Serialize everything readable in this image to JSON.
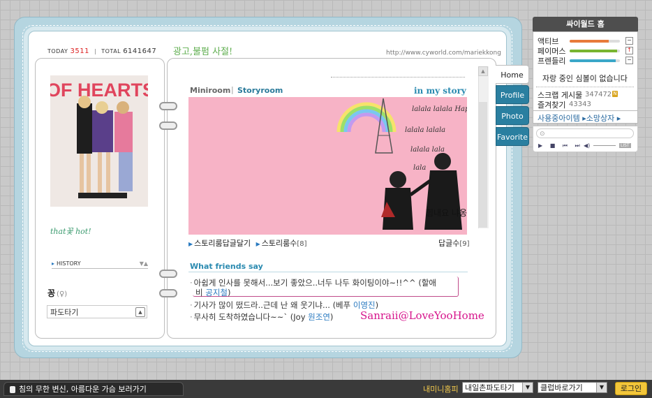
{
  "header": {
    "today_label": "TODAY",
    "today_count": "3511",
    "total_label": "TOTAL",
    "total_count": "6141647",
    "title": "광고,불펌 사절!",
    "url": "http://www.cyworld.com/mariekkong"
  },
  "left_page": {
    "profile_image_text": "OF HEARTS",
    "profile_note": "that꽃 hot!",
    "history_label": "HISTORY",
    "owner_name": "꽁",
    "owner_gender": "(♀)",
    "pado_label": "파도타기"
  },
  "right_page": {
    "tab_miniroom": "Miniroom",
    "tab_storyroom": "Storyroom",
    "in_my_story": "in my story",
    "story_image_text": "lalala lalala Happy lalala",
    "story_image_caption": "힘내요 냐옹",
    "story_reply_link": "스토리룸답글달기",
    "story_count_link": "스토리룸수",
    "story_count": "[8]",
    "reply_label": "답글수",
    "reply_count": "[9]",
    "friends_title": "What friends say",
    "comments": [
      {
        "text": "아쉽게 인사를 못해서...보기 좋았으..너두 나두 화이팅이야~!!^^ (할애",
        "cont": "비",
        "who": "공지철",
        "tail": ")"
      },
      {
        "text": "기사가 많이 떴드라..근데 난 왜 웃기냐... (베푸 ",
        "who": "이영진",
        "tail": ")"
      },
      {
        "text": "무사히 도착하였습니다~~` (Joy ",
        "who": "원조연",
        "tail": ")"
      }
    ],
    "watermark": "Sanraii@LoveYooHome"
  },
  "side_tabs": [
    "Home",
    "Profile",
    "Photo",
    "Favorite"
  ],
  "world": {
    "header": "싸이월드 홈",
    "meters": [
      {
        "label": "액티브",
        "color": "#e87a3a",
        "value": 0.78,
        "btn": "−"
      },
      {
        "label": "페이머스",
        "color": "#79b530",
        "value": 0.94,
        "btn": "↑"
      },
      {
        "label": "프렌들리",
        "color": "#3aa7c8",
        "value": 0.92,
        "btn": "−"
      }
    ],
    "status": "자랑 중인 심볼이 없습니다",
    "scrap_label": "스크랩 게시물",
    "scrap_count": "347472",
    "n_badge": "N",
    "fav_label": "즐겨찾기",
    "fav_count": "43343",
    "items_link": "사용중아이템 ▸소망상자 ▸",
    "player_controls": "▶ ■ ⏮ ⏭",
    "player_vol_icon": "◀)",
    "player_list": "LIST"
  },
  "bottom": {
    "ad_text": "침의 무한 변신, 아름다운 가슴 보러가기",
    "mini_link": "내미니홈피",
    "select1": "내일촌파도타기",
    "select2": "클럽바로가기",
    "login": "로그인"
  }
}
